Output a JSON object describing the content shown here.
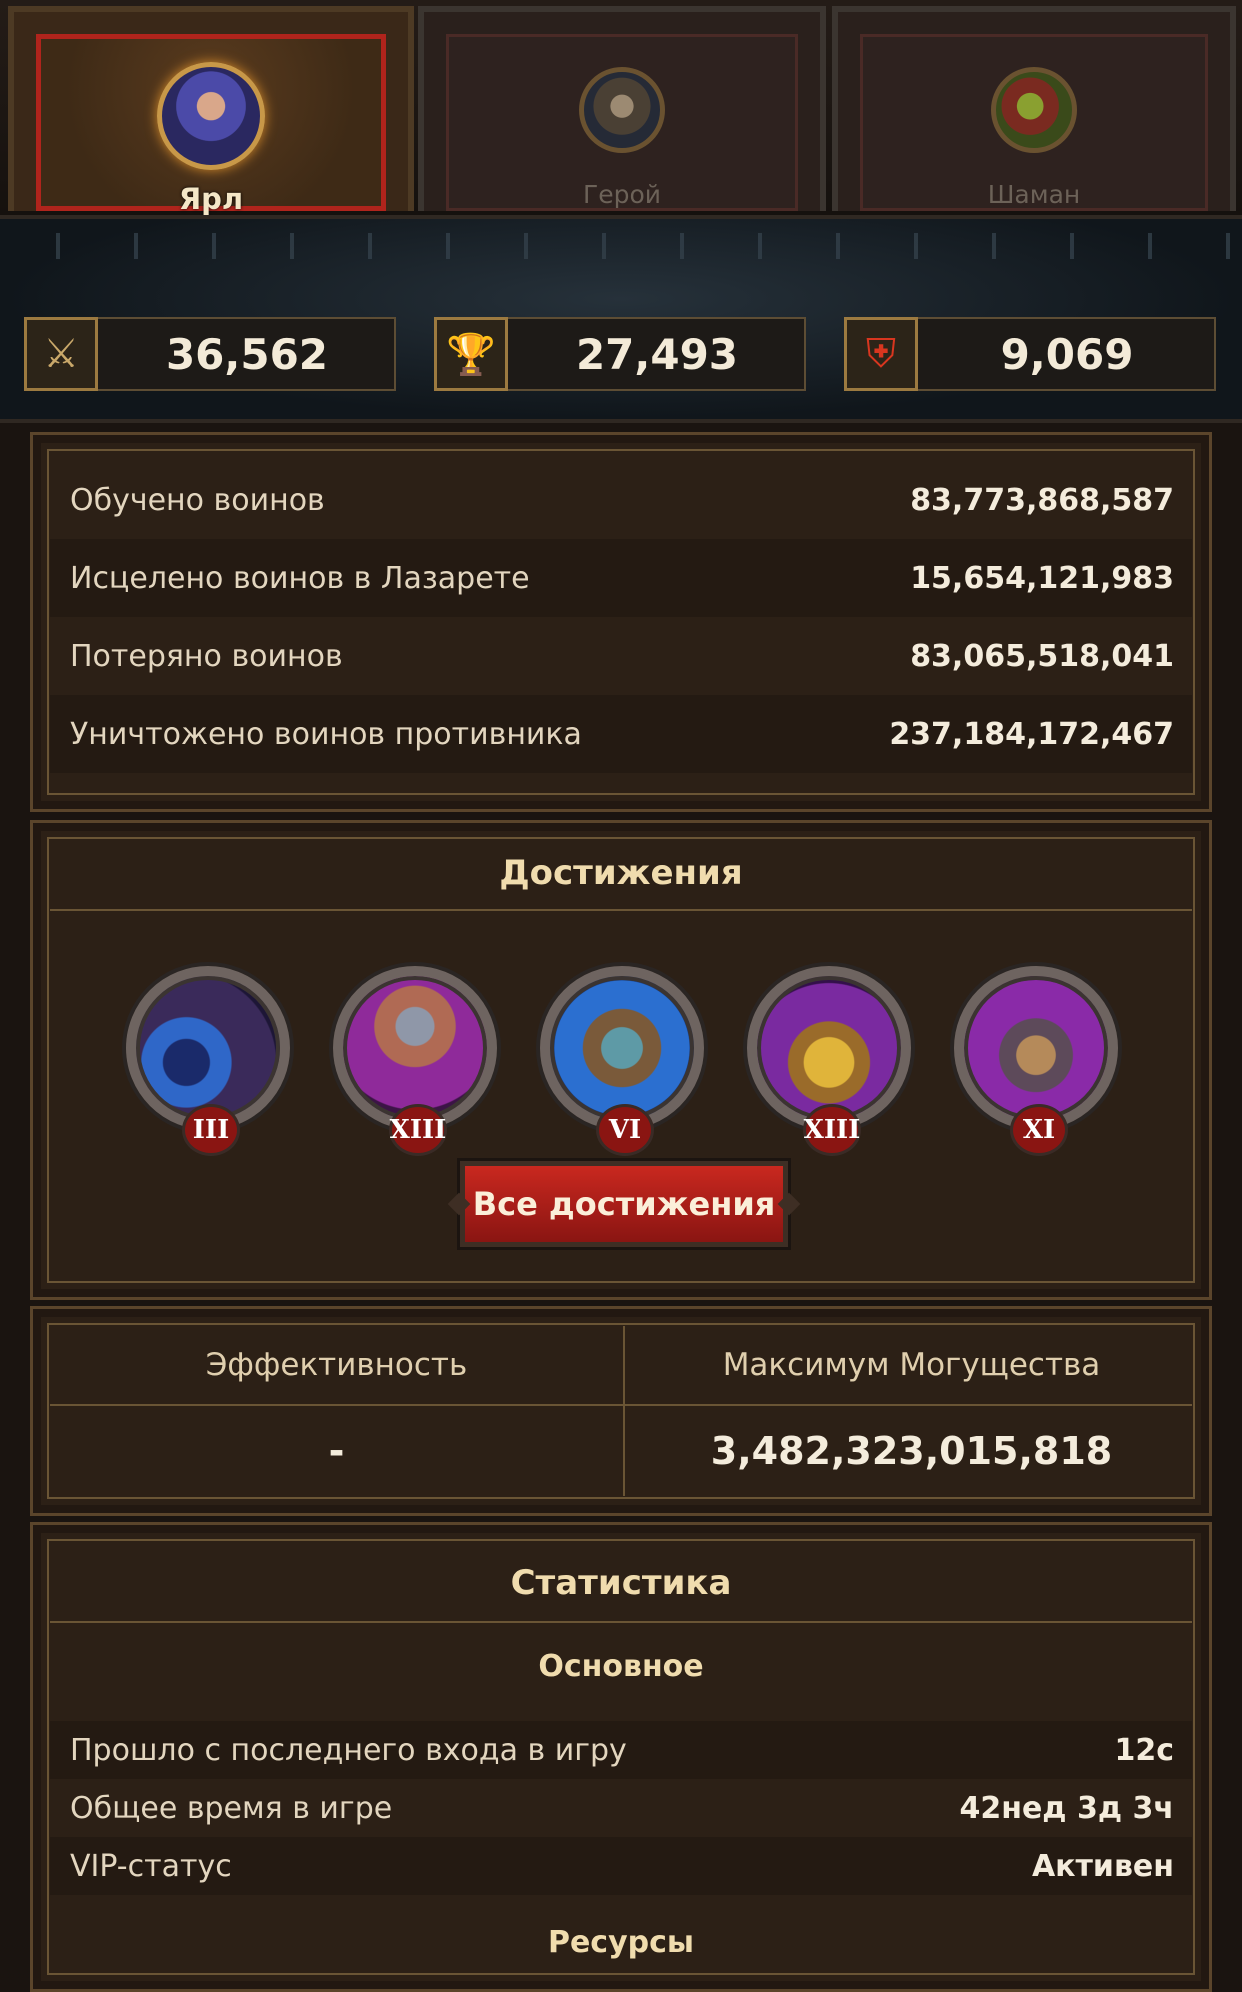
{
  "tabs": [
    {
      "label": "Ярл",
      "active": true
    },
    {
      "label": "Герой",
      "active": false
    },
    {
      "label": "Шаман",
      "active": false
    }
  ],
  "stats_bar": {
    "power": "36,562",
    "trophies": "27,493",
    "kills": "9,069"
  },
  "troops": [
    {
      "label": "Обучено воинов",
      "value": "83,773,868,587"
    },
    {
      "label": "Исцелено воинов в Лазарете",
      "value": "15,654,121,983"
    },
    {
      "label": "Потеряно воинов",
      "value": "83,065,518,041"
    },
    {
      "label": "Уничтожено воинов противника",
      "value": "237,184,172,467"
    }
  ],
  "achievements": {
    "title": "Достижения",
    "items": [
      {
        "rank": "III",
        "icon": "comet-icon"
      },
      {
        "rank": "XIII",
        "icon": "viking-warrior-icon"
      },
      {
        "rank": "VI",
        "icon": "globe-icon"
      },
      {
        "rank": "XIII",
        "icon": "treasure-chest-icon"
      },
      {
        "rank": "XI",
        "icon": "axe-stump-icon"
      }
    ],
    "all_button": "Все достижения"
  },
  "efficiency": {
    "col1_header": "Эффективность",
    "col2_header": "Максимум Могущества",
    "col1_value": "-",
    "col2_value": "3,482,323,015,818"
  },
  "statistics": {
    "title": "Статистика",
    "subtitle": "Основное",
    "rows": [
      {
        "label": "Прошло с последнего входа в игру",
        "value": "12с"
      },
      {
        "label": "Общее время в игре",
        "value": "42нед 3д 3ч"
      },
      {
        "label": "VIP-статус",
        "value": "Активен"
      }
    ],
    "next_section": "Ресурсы"
  },
  "colors": {
    "accent_red": "#b0241c",
    "gold": "#c89848"
  }
}
